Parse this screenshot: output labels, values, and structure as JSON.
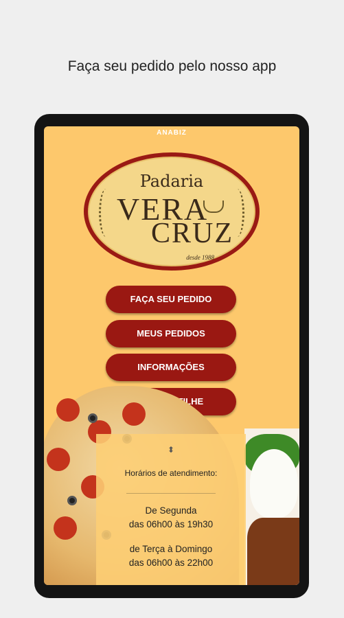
{
  "headline": "Faça seu pedido pelo nosso app",
  "brand": "ANABIZ",
  "logo": {
    "padaria": "Padaria",
    "vera": "VERA",
    "cruz": "CRUZ",
    "desde": "desde 1988"
  },
  "buttons": [
    {
      "label": "FAÇA SEU PEDIDO"
    },
    {
      "label": "MEUS PEDIDOS"
    },
    {
      "label": "INFORMAÇÕES"
    },
    {
      "label": "COMPARTILHE"
    }
  ],
  "hours": {
    "chevron": "⬍",
    "title": "Horários de atendimento:",
    "block1_days": "De Segunda",
    "block1_time": "das 06h00 às 19h30",
    "block2_days": "de Terça à Domingo",
    "block2_time": "das 06h00 às 22h00"
  },
  "colors": {
    "background": "#fdc86c",
    "button": "#9a1812",
    "logo_ring": "#9a1a14"
  }
}
